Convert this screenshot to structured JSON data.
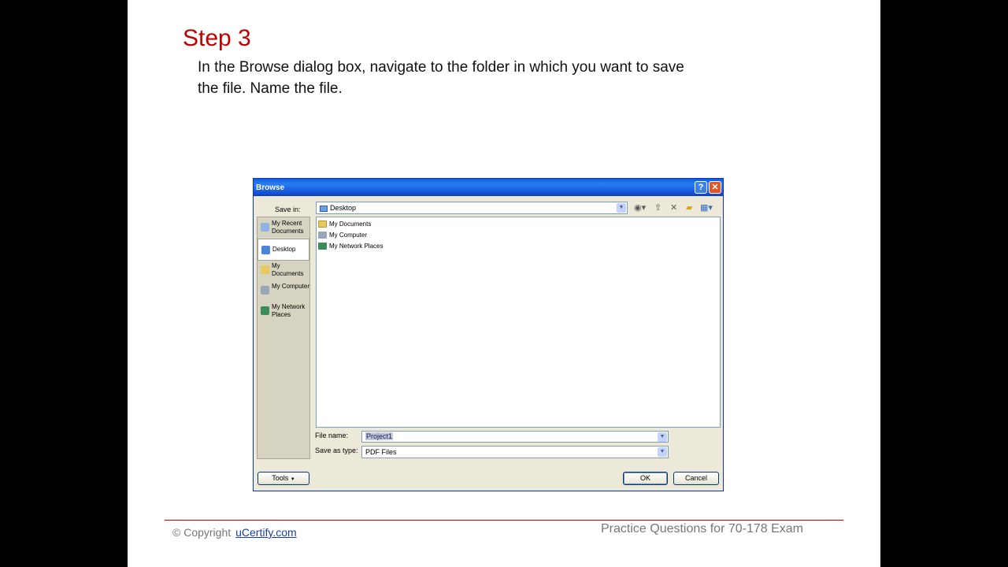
{
  "slide": {
    "step_title": "Step 3",
    "instruction": "In the Browse dialog box, navigate to the folder in which you want to save the file. Name the file."
  },
  "dialog": {
    "title": "Browse",
    "help_glyph": "?",
    "close_glyph": "✕",
    "save_in_label": "Save in:",
    "save_in_value": "Desktop",
    "toolbar_icons": [
      "back-icon",
      "up-folder-icon",
      "delete-icon",
      "new-folder-icon",
      "views-icon"
    ],
    "places": [
      {
        "label": "My Recent Documents",
        "icon": "recent-documents-icon",
        "active": false
      },
      {
        "label": "Desktop",
        "icon": "desktop-icon",
        "active": true
      },
      {
        "label": "My Documents",
        "icon": "my-documents-icon",
        "active": false
      },
      {
        "label": "My Computer",
        "icon": "my-computer-icon",
        "active": false
      },
      {
        "label": "My Network Places",
        "icon": "network-places-icon",
        "active": false
      }
    ],
    "files": [
      {
        "label": "My Documents",
        "icon": "folder-icon"
      },
      {
        "label": "My Computer",
        "icon": "computer-icon"
      },
      {
        "label": "My Network Places",
        "icon": "network-icon"
      }
    ],
    "file_name_label": "File name:",
    "file_name_value": "Project1",
    "save_as_type_label": "Save as type:",
    "save_as_type_value": "PDF Files",
    "tools_label": "Tools",
    "ok_label": "OK",
    "cancel_label": "Cancel"
  },
  "footer": {
    "copyright": "© Copyright",
    "link": "uCertify.com",
    "right": "Practice Questions for 70-178 Exam"
  },
  "colors": {
    "step_title": "#c00000",
    "titlebar": "#0a5fd8",
    "footer_line": "#c00000"
  }
}
